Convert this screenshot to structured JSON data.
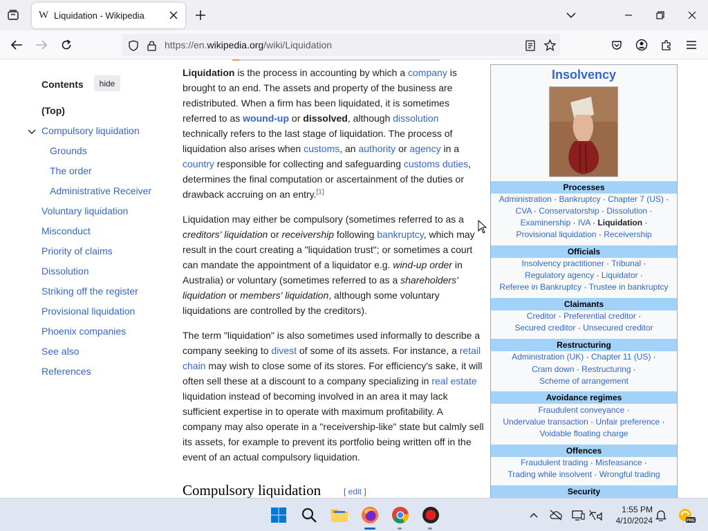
{
  "browser": {
    "tab": {
      "favicon": "W",
      "title": "Liquidation - Wikipedia"
    },
    "url": {
      "prefix": "https://en.",
      "domain": "wikipedia.org",
      "path": "/wiki/Liquidation"
    }
  },
  "toc": {
    "heading": "Contents",
    "hide_label": "hide",
    "items": [
      "(Top)",
      "Compulsory liquidation",
      "Grounds",
      "The order",
      "Administrative Receiver",
      "Voluntary liquidation",
      "Misconduct",
      "Priority of claims",
      "Dissolution",
      "Striking off the register",
      "Provisional liquidation",
      "Phoenix companies",
      "See also",
      "References"
    ]
  },
  "article": {
    "p1": {
      "t1": "Liquidation",
      "t2": " is the process in accounting by which a ",
      "l1": "company",
      "t3": " is brought to an end. The assets and property of the business are redistributed. When a firm has been liquidated, it is sometimes referred to as ",
      "l2": "wound-up",
      "t4": " or ",
      "t5": "dissolved",
      "t6": ", although ",
      "l3": "dissolution",
      "t7": " technically refers to the last stage of liquidation. The process of liquidation also arises when ",
      "l4": "customs",
      "t8": ", an ",
      "l5": "authority",
      "t9": " or ",
      "l6": "agency",
      "t10": " in a ",
      "l7": "country",
      "t11": " responsible for collecting and safeguarding ",
      "l8": "customs duties",
      "t12": ", determines the final computation or ascertainment of the duties or drawback accruing on an entry.",
      "ref": "[1]"
    },
    "p2": {
      "t1": "Liquidation may either be compulsory (sometimes referred to as a ",
      "i1": "creditors' liquidation",
      "t2": " or ",
      "i2": "receivership",
      "t3": " following ",
      "l1": "bankruptcy",
      "t4": ", which may result in the court creating a \"liquidation trust\"; or sometimes a court can mandate the appointment of a liquidator e.g. ",
      "i3": "wind-up order",
      "t5": " in Australia) or voluntary (sometimes referred to as a ",
      "i4": "shareholders' liquidation",
      "t6": " or ",
      "i5": "members' liquidation",
      "t7": ", although some voluntary liquidations are controlled by the creditors)."
    },
    "p3": {
      "t1": "The term \"liquidation\" is also sometimes used informally to describe a company seeking to ",
      "l1": "divest",
      "t2": " of some of its assets. For instance, a ",
      "l2": "retail chain",
      "t3": " may wish to close some of its stores. For efficiency's sake, it will often sell these at a discount to a company specializing in ",
      "l3": "real estate",
      "t4": " liquidation instead of becoming involved in an area it may lack sufficient expertise in to operate with maximum profitability. A company may also operate in a \"receivership-like\" state but calmly sell its assets, for example to prevent its portfolio being written off in the event of an actual compulsory liquidation."
    },
    "section_heading": "Compulsory liquidation",
    "edit": {
      "open": "[ ",
      "label": "edit",
      "close": " ]"
    }
  },
  "infobox": {
    "title": "Insolvency",
    "image_alt": "painting-of-hand-holding-purse",
    "sections": [
      {
        "head": "Processes",
        "lines": [
          [
            "Administration",
            "Bankruptcy",
            "Chapter 7 (US)"
          ],
          [
            "CVA",
            "Conservatorship",
            "Dissolution"
          ],
          [
            "Examinership",
            "IVA",
            "Liquidation"
          ],
          [
            "Provisional liquidation",
            "Receivership"
          ]
        ]
      },
      {
        "head": "Officials",
        "lines": [
          [
            "Insolvency practitioner",
            "Tribunal"
          ],
          [
            "Regulatory agency",
            "Liquidator"
          ],
          [
            "Referee in Bankruptcy",
            "Trustee in bankruptcy"
          ]
        ]
      },
      {
        "head": "Claimants",
        "lines": [
          [
            "Creditor",
            "Preferential creditor"
          ],
          [
            "Secured creditor",
            "Unsecured creditor"
          ]
        ]
      },
      {
        "head": "Restructuring",
        "lines": [
          [
            "Administration (UK)",
            "Chapter 11 (US)"
          ],
          [
            "Cram down",
            "Restructuring"
          ],
          [
            "Scheme of arrangement"
          ]
        ]
      },
      {
        "head": "Avoidance regimes",
        "lines": [
          [
            "Fraudulent conveyance"
          ],
          [
            "Undervalue transaction",
            "Unfair preference"
          ],
          [
            "Voidable floating charge"
          ]
        ]
      },
      {
        "head": "Offences",
        "lines": [
          [
            "Fraudulent trading",
            "Misfeasance"
          ],
          [
            "Trading while insolvent",
            "Wrongful trading"
          ]
        ]
      },
      {
        "head": "Security",
        "lines": []
      }
    ]
  },
  "taskbar": {
    "time": "1:55 PM",
    "date": "4/10/2024",
    "apps": [
      "windows-start",
      "search",
      "file-explorer",
      "firefox",
      "chrome",
      "recorder"
    ]
  },
  "colors": {
    "link": "#3366cc",
    "infobox_head": "#a2d2f7",
    "taskbar": "#dfe6f1"
  }
}
